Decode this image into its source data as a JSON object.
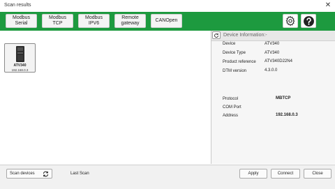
{
  "window": {
    "title": "Scan results",
    "close_glyph": "✕"
  },
  "toolbar": {
    "buttons": [
      {
        "line1": "Modbus",
        "line2": "Serial"
      },
      {
        "line1": "Modbus",
        "line2": "TCP"
      },
      {
        "line1": "Modbus",
        "line2": "IPV6"
      },
      {
        "line1": "Remote",
        "line2": "gateway"
      },
      {
        "line1": "CANOpen",
        "line2": ""
      }
    ],
    "settings_icon": "gear-icon",
    "help_icon": "help-icon",
    "accent_color": "#1d9a3f"
  },
  "device": {
    "name": "ATV340",
    "ip": "192.168.0.3"
  },
  "info": {
    "title": "Device Information:-",
    "refresh_icon": "refresh-icon",
    "fields": [
      {
        "label": "Device",
        "value": "ATV340"
      },
      {
        "label": "Device Type",
        "value": "ATV340"
      },
      {
        "label": "Product reference",
        "value": "ATV340D22N4"
      },
      {
        "label": "DTM version",
        "value": "4.3.0.0"
      }
    ],
    "protocol_label": "Protocol",
    "protocol_value": "MBTCP",
    "comport_label": "COM Port",
    "comport_value": "",
    "address_label": "Address",
    "address_value": "192.168.0.3"
  },
  "bottom": {
    "scan_label": "Scan devices",
    "scan_icon": "refresh-icon",
    "last_scan_label": "Last Scan",
    "apply_label": "Apply",
    "connect_label": "Connect",
    "close_label": "Close"
  }
}
